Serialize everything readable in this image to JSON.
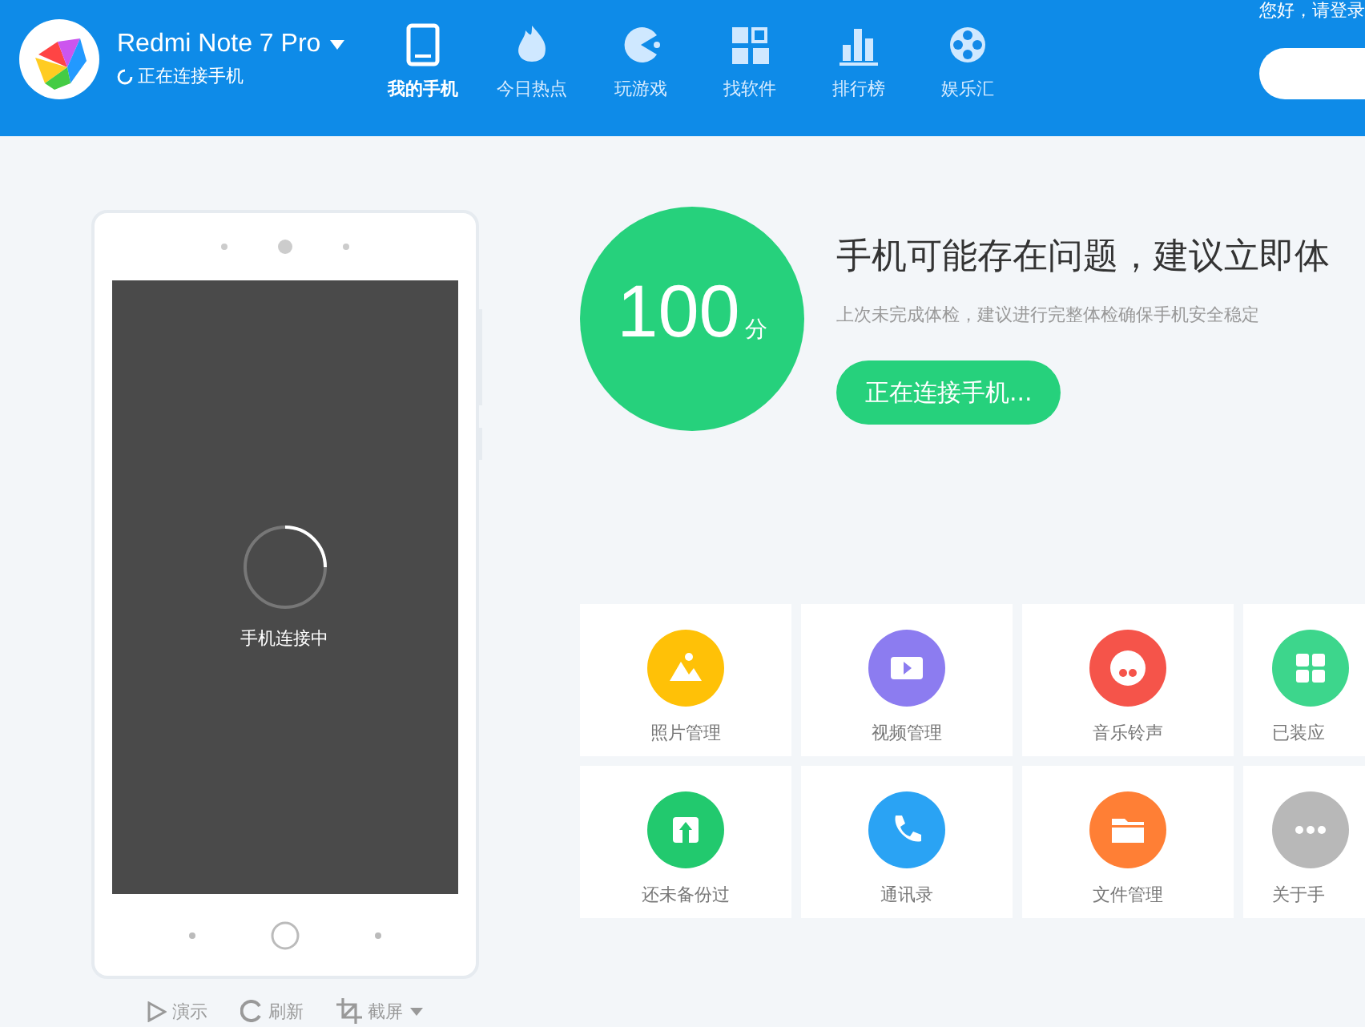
{
  "header": {
    "device_name": "Redmi Note 7 Pro",
    "connection_status": "正在连接手机",
    "greeting": "您好，请登录",
    "nav": [
      {
        "label": "我的手机",
        "selected": true
      },
      {
        "label": "今日热点",
        "selected": false
      },
      {
        "label": "玩游戏",
        "selected": false
      },
      {
        "label": "找软件",
        "selected": false
      },
      {
        "label": "排行榜",
        "selected": false
      },
      {
        "label": "娱乐汇",
        "selected": false
      }
    ]
  },
  "phone": {
    "screen_status": "手机连接中",
    "tools": [
      {
        "label": "演示"
      },
      {
        "label": "刷新"
      },
      {
        "label": "截屏"
      }
    ]
  },
  "checkup": {
    "score": "100",
    "unit": "分",
    "title": "手机可能存在问题，建议立即体",
    "subtitle": "上次未完成体检，建议进行完整体检确保手机安全稳定",
    "button": "正在连接手机..."
  },
  "tools": [
    {
      "label": "照片管理",
      "color": "#ffc107"
    },
    {
      "label": "视频管理",
      "color": "#8c7cf0"
    },
    {
      "label": "音乐铃声",
      "color": "#f5544a"
    },
    {
      "label": "已装应",
      "color": "#3dd68c"
    },
    {
      "label": "还未备份过",
      "color": "#22c96e"
    },
    {
      "label": "通讯录",
      "color": "#2aa3f4"
    },
    {
      "label": "文件管理",
      "color": "#ff7f35"
    },
    {
      "label": "关于手",
      "color": "#b8b8b8"
    }
  ]
}
